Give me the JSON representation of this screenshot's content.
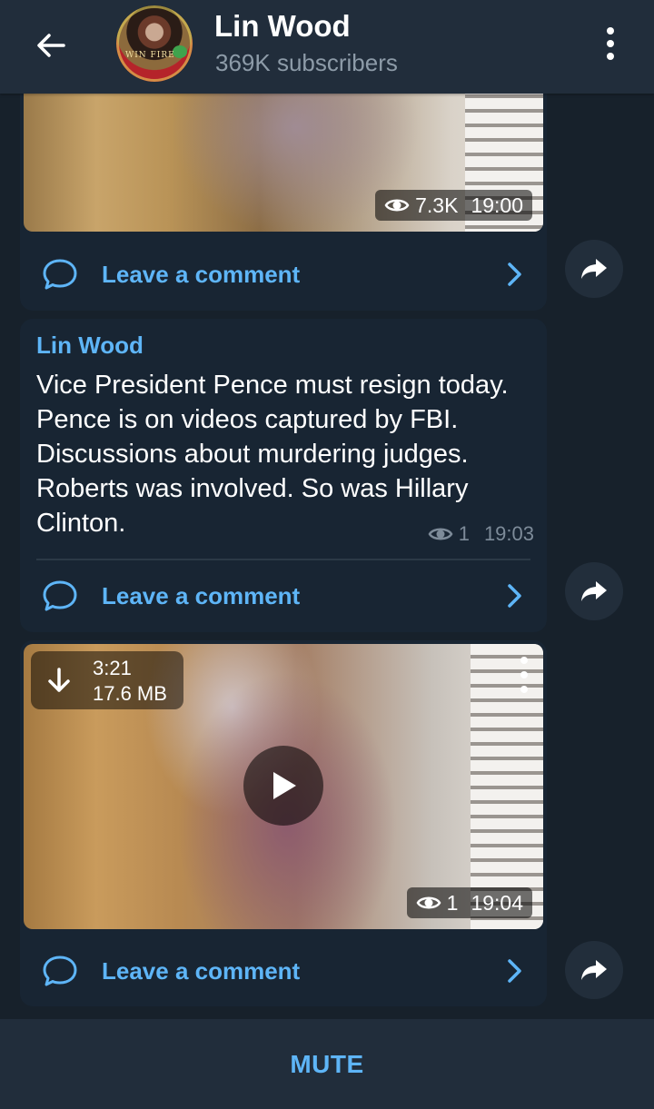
{
  "header": {
    "title": "Lin Wood",
    "subtitle": "369K subscribers",
    "avatar_text": "WIN FIRE"
  },
  "messages": [
    {
      "type": "video",
      "views": "7.3K",
      "time": "19:00",
      "comment_label": "Leave a comment"
    },
    {
      "type": "text",
      "sender": "Lin Wood",
      "text": "Vice President Pence must resign today. Pence is on videos captured by FBI. Discussions about murdering judges. Roberts was involved. So was Hillary Clinton.",
      "views": "1",
      "time": "19:03",
      "comment_label": "Leave a comment"
    },
    {
      "type": "video",
      "duration": "3:21",
      "size": "17.6 MB",
      "views": "1",
      "time": "19:04",
      "comment_label": "Leave a comment"
    }
  ],
  "footer": {
    "mute_label": "MUTE"
  },
  "colors": {
    "background": "#17212b",
    "header": "#212d3b",
    "card": "#182533",
    "accent": "#5eb5f7",
    "meta": "#7d8b99"
  },
  "icons": [
    "back-arrow-icon",
    "more-vertical-icon",
    "eye-icon",
    "comment-bubble-icon",
    "chevron-right-icon",
    "share-arrow-icon",
    "download-icon",
    "play-icon"
  ]
}
